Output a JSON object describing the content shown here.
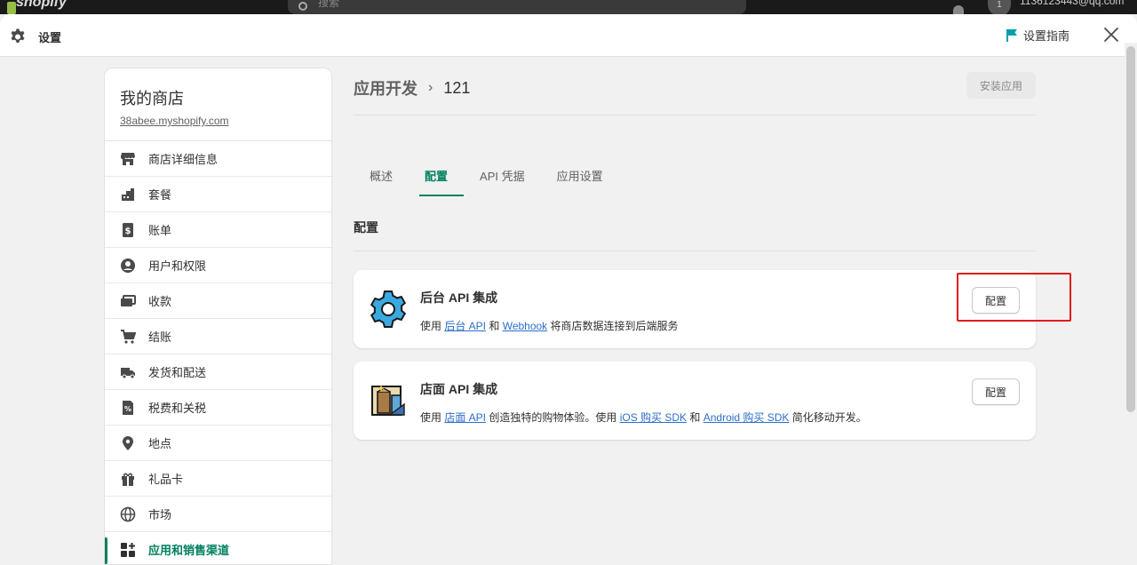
{
  "background_bar": {
    "logo_text": "shopify",
    "search_placeholder": "搜索",
    "avatar_initial": "1",
    "email": "1136123443@qq.com"
  },
  "header": {
    "title": "设置",
    "guide_label": "设置指南",
    "icons": {
      "settings": "gear-icon",
      "guide": "flag-icon",
      "close": "close-icon"
    },
    "accent_color": "#00a0ac"
  },
  "sidebar": {
    "store_name": "我的商店",
    "store_url": "38abee.myshopify.com",
    "items": [
      {
        "label": "商店详细信息",
        "icon": "store-icon"
      },
      {
        "label": "套餐",
        "icon": "plan-icon"
      },
      {
        "label": "账单",
        "icon": "billing-icon"
      },
      {
        "label": "用户和权限",
        "icon": "user-icon"
      },
      {
        "label": "收款",
        "icon": "payments-icon"
      },
      {
        "label": "结账",
        "icon": "cart-icon"
      },
      {
        "label": "发货和配送",
        "icon": "truck-icon"
      },
      {
        "label": "税费和关税",
        "icon": "tax-icon"
      },
      {
        "label": "地点",
        "icon": "location-icon"
      },
      {
        "label": "礼品卡",
        "icon": "gift-icon"
      },
      {
        "label": "市场",
        "icon": "globe-icon"
      },
      {
        "label": "应用和销售渠道",
        "icon": "apps-icon",
        "active": true
      }
    ],
    "active_color": "#008060"
  },
  "main": {
    "breadcrumb_parent": "应用开发",
    "breadcrumb_sep": "›",
    "breadcrumb_current": "121",
    "install_button": "安装应用",
    "tabs": [
      {
        "label": "概述"
      },
      {
        "label": "配置",
        "active": true
      },
      {
        "label": "API 凭据"
      },
      {
        "label": "应用设置"
      }
    ],
    "section_title": "配置",
    "cards": [
      {
        "title": "后台 API 集成",
        "icon": "gear-integration-icon",
        "desc_prefix": "使用 ",
        "link1": "后台 API",
        "desc_mid": " 和 ",
        "link2": "Webhook",
        "desc_suffix": " 将商店数据连接到后端服务",
        "button": "配置"
      },
      {
        "title": "店面 API 集成",
        "icon": "storefront-integration-icon",
        "desc_prefix": "使用 ",
        "link1": "店面 API",
        "desc_mid": " 创造独特的购物体验。使用 ",
        "link2": "iOS 购买 SDK",
        "desc_mid2": " 和 ",
        "link3": "Android 购买 SDK",
        "desc_suffix": " 简化移动开发。",
        "button": "配置"
      }
    ],
    "link_color": "#2c6ecb",
    "highlight_color": "#e01b1b"
  }
}
